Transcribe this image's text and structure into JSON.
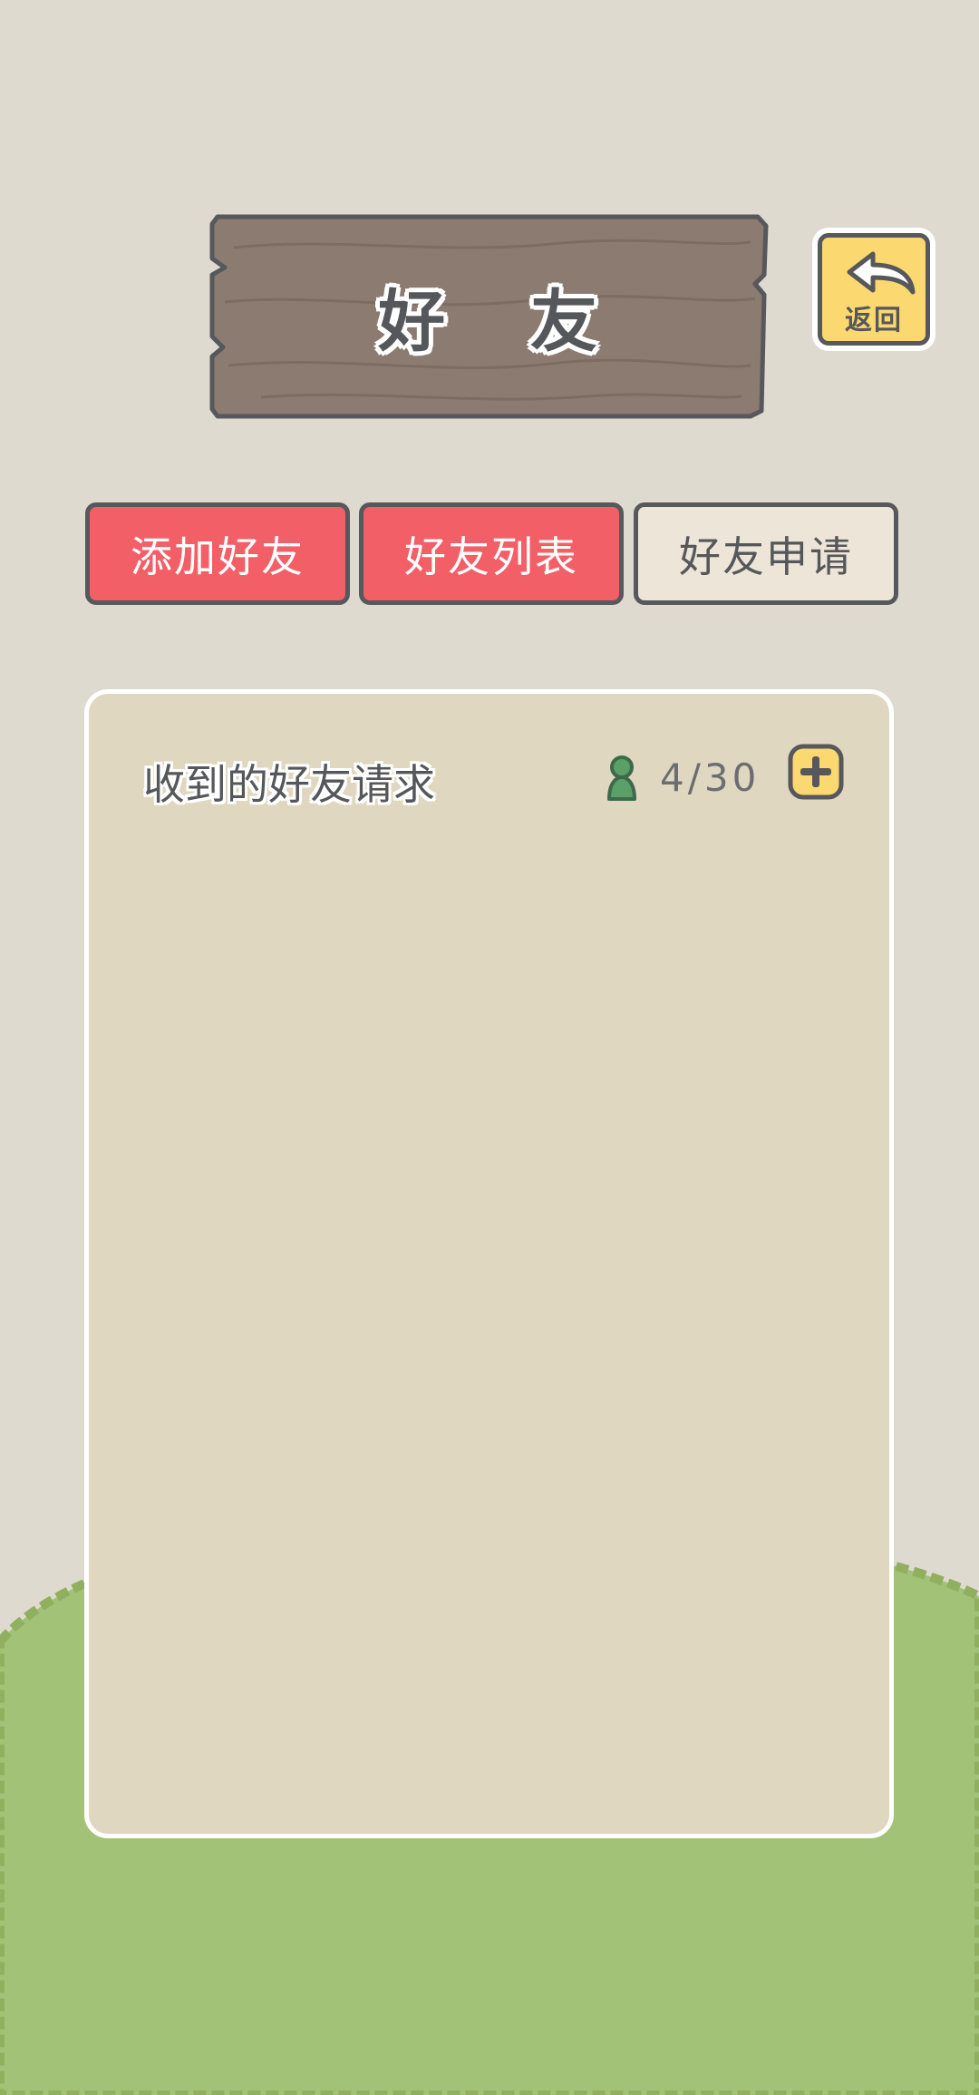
{
  "header": {
    "title": "好 友",
    "back_label": "返回"
  },
  "tabs": [
    {
      "label": "添加好友",
      "state": "red"
    },
    {
      "label": "好友列表",
      "state": "red"
    },
    {
      "label": "好友申请",
      "state": "selected"
    }
  ],
  "panel": {
    "title": "收到的好友请求",
    "count": "4/30",
    "icons": [
      "person-icon",
      "plus-icon"
    ]
  },
  "colors": {
    "background": "#dedad0",
    "grass": "#a1c277",
    "grass_outline": "#90b060",
    "wood": "#8b7b70",
    "button_red": "#f25f67",
    "button_yellow": "#fbd870",
    "panel_fill": "#dfd7c0",
    "outline": "#56585b",
    "person_green": "#5ba068"
  }
}
